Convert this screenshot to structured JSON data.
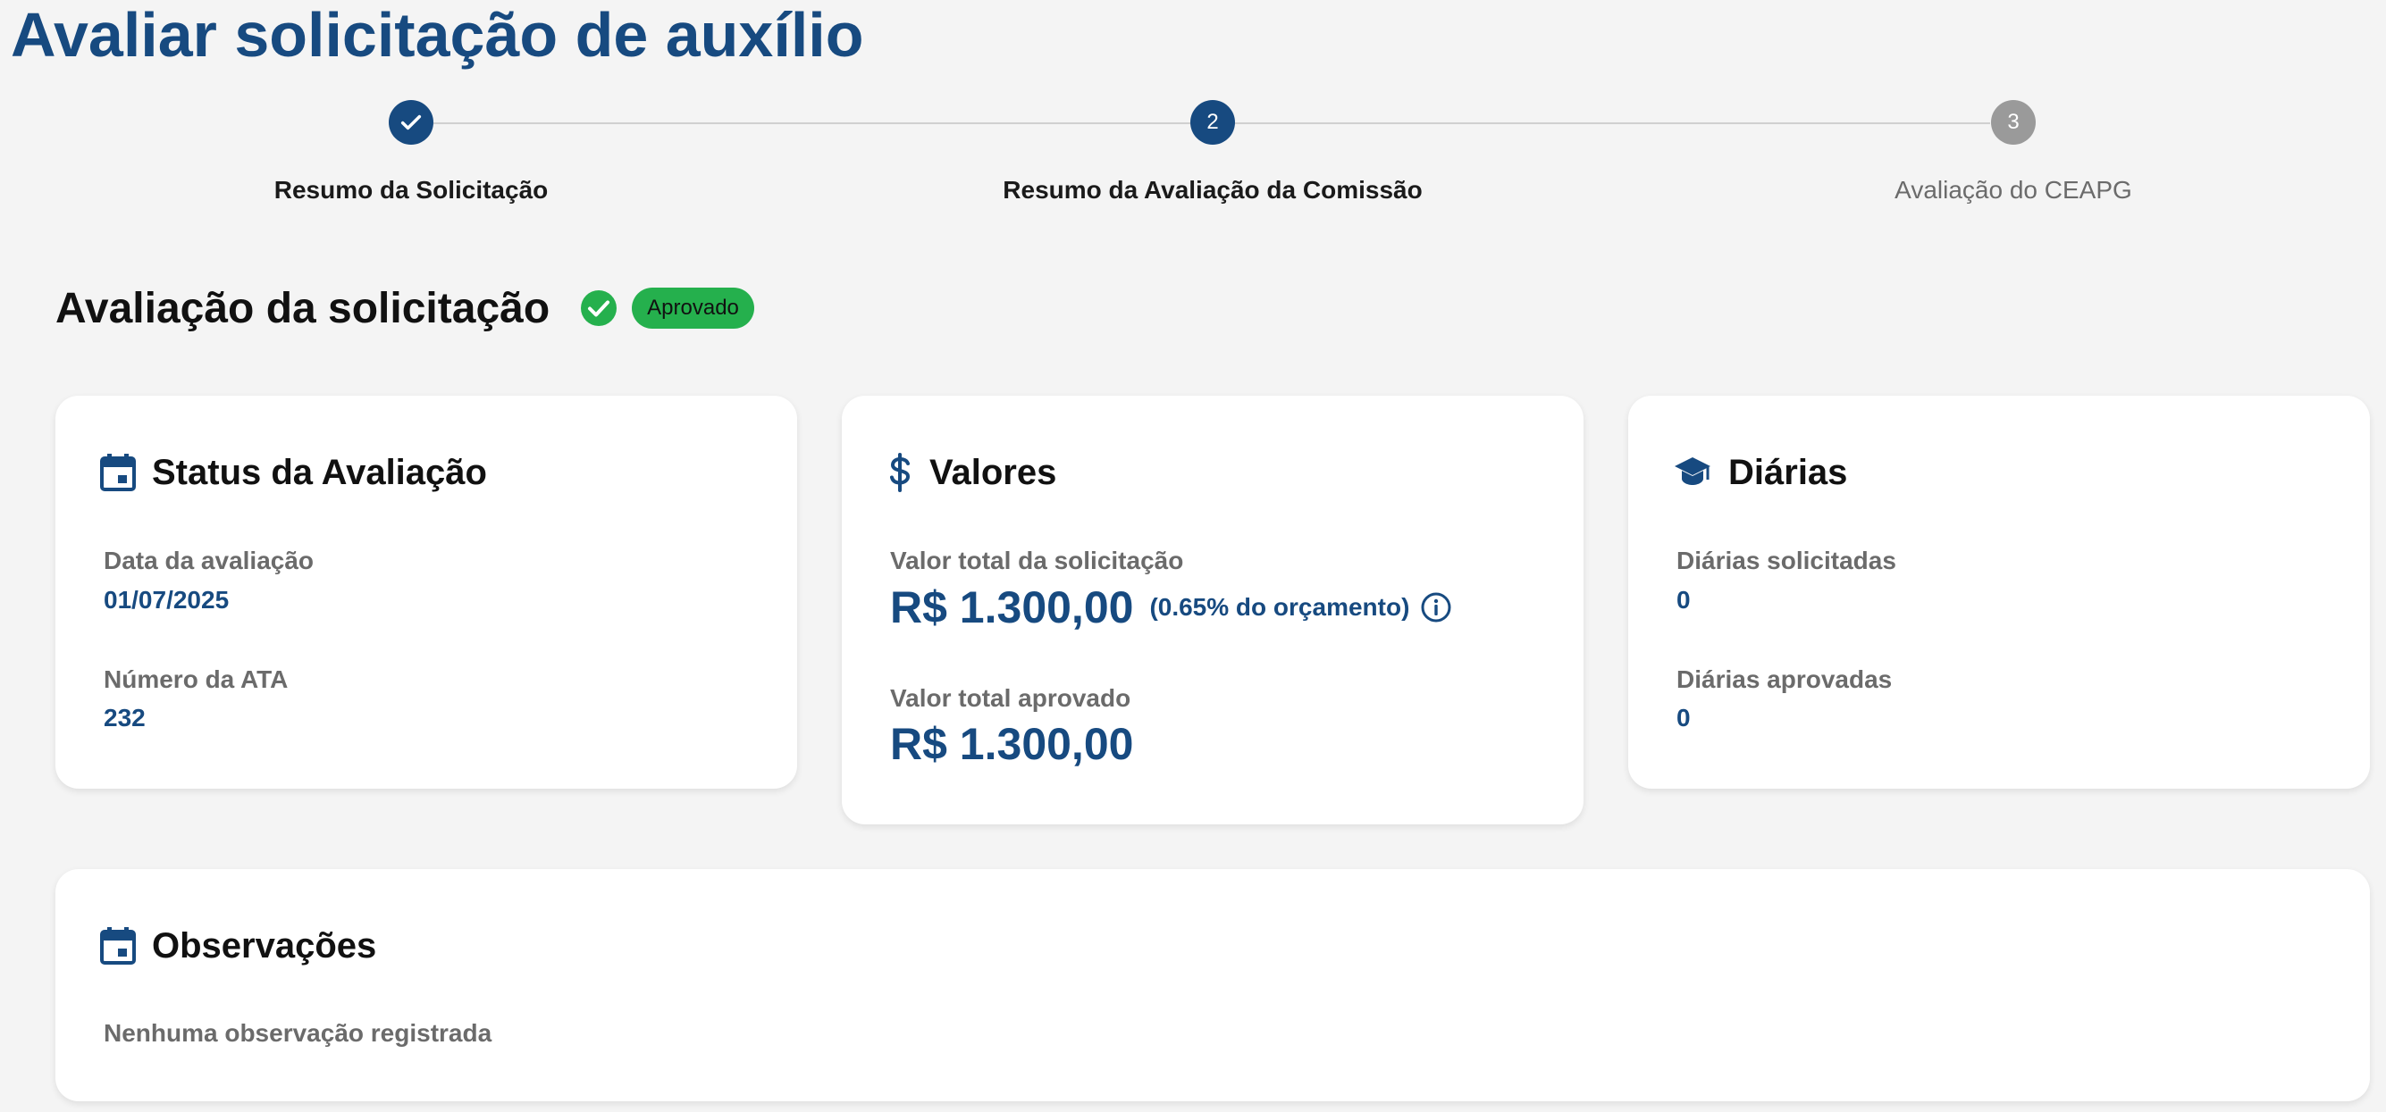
{
  "page": {
    "title": "Avaliar solicitação de auxílio"
  },
  "stepper": {
    "steps": [
      {
        "number": "1",
        "label": "Resumo da Solicitação",
        "state": "done"
      },
      {
        "number": "2",
        "label": "Resumo da Avaliação da Comissão",
        "state": "active"
      },
      {
        "number": "3",
        "label": "Avaliação do CEAPG",
        "state": "pending"
      }
    ]
  },
  "evaluation": {
    "title": "Avaliação da solicitação",
    "status_badge": "Aprovado"
  },
  "status_card": {
    "icon": "calendar-icon",
    "title": "Status da Avaliação",
    "date_label": "Data da avaliação",
    "date_value": "01/07/2025",
    "ata_label": "Número da ATA",
    "ata_value": "232"
  },
  "values_card": {
    "icon": "dollar-icon",
    "title": "Valores",
    "total_requested_label": "Valor total da solicitação",
    "total_requested_value": "R$ 1.300,00",
    "budget_percentage": "(0.65% do orçamento)",
    "total_approved_label": "Valor total aprovado",
    "total_approved_value": "R$ 1.300,00"
  },
  "diarias_card": {
    "icon": "graduation-cap-icon",
    "title": "Diárias",
    "requested_label": "Diárias solicitadas",
    "requested_value": "0",
    "approved_label": "Diárias aprovadas",
    "approved_value": "0"
  },
  "observations_card": {
    "icon": "calendar-icon",
    "title": "Observações",
    "empty_text": "Nenhuma observação registrada"
  },
  "colors": {
    "primary": "#174a80",
    "success": "#25b04d",
    "pending": "#9a9a9a",
    "background": "#f4f4f4"
  }
}
